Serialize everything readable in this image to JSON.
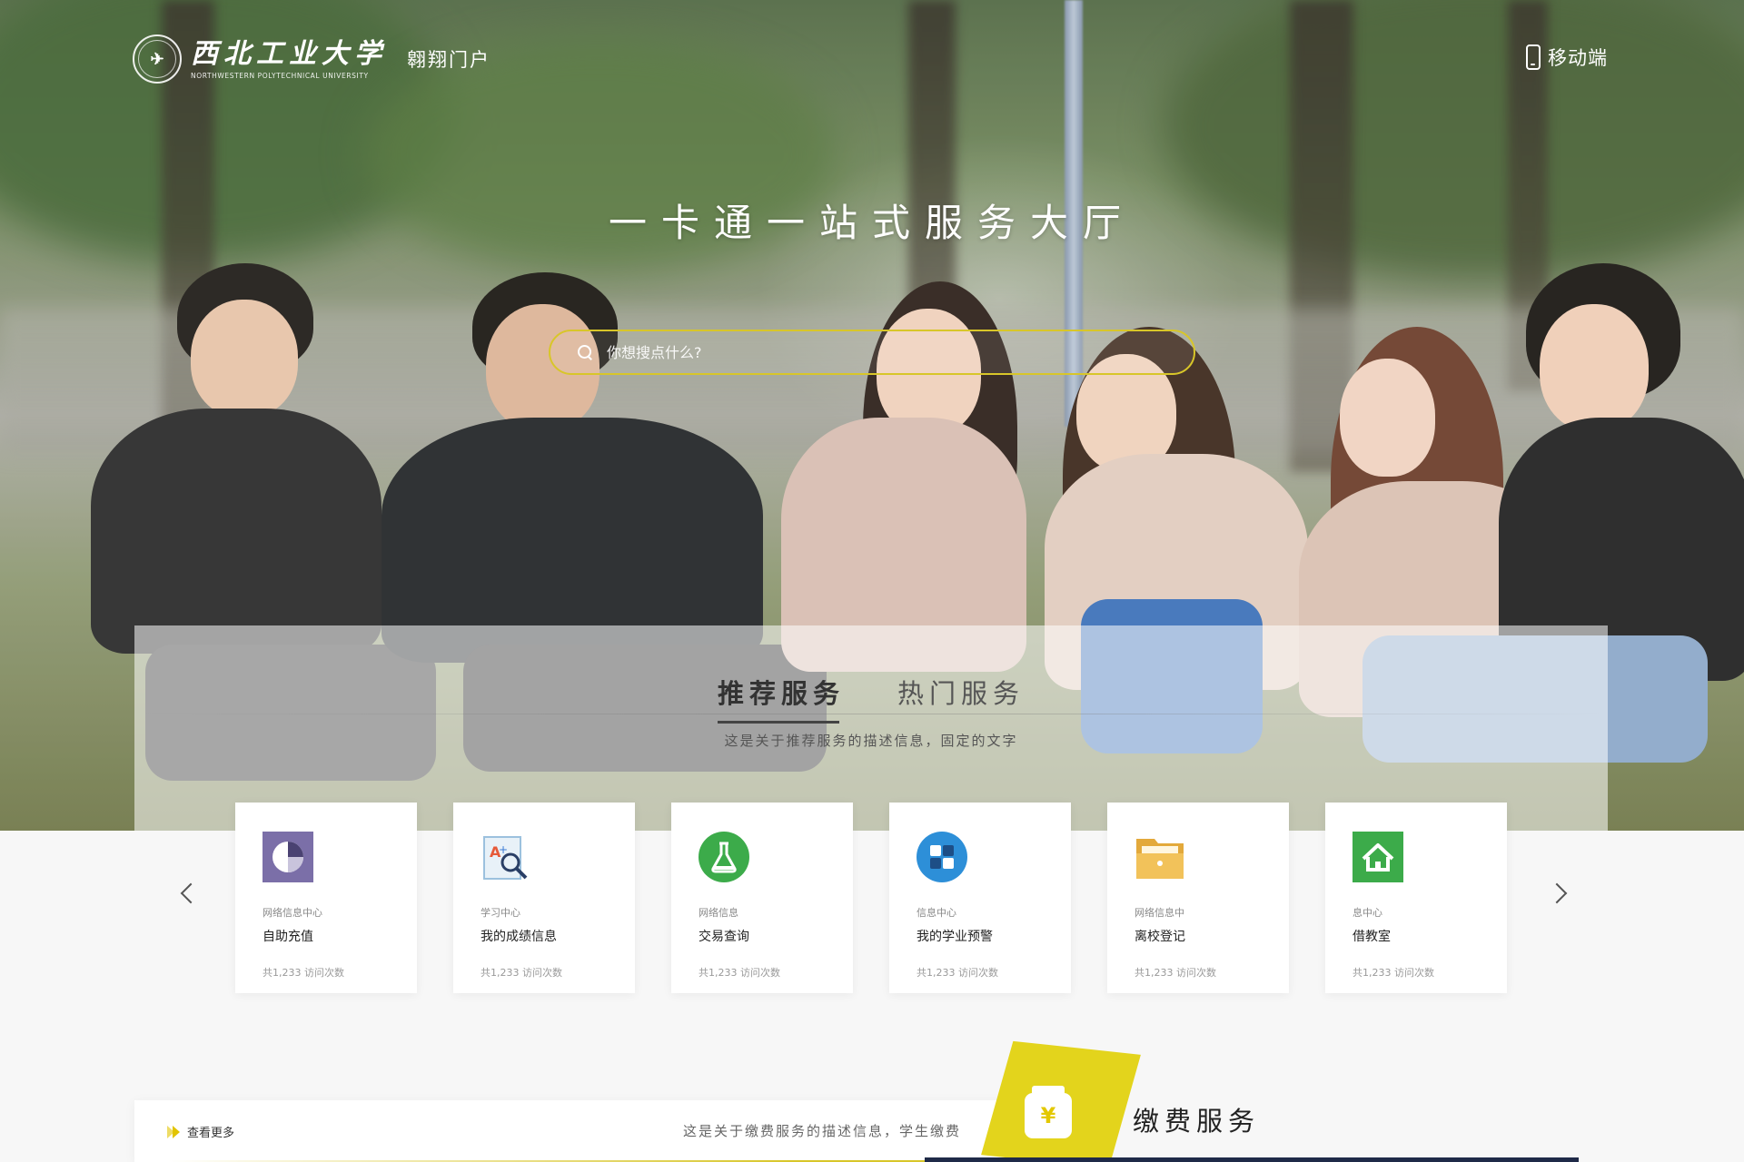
{
  "header": {
    "school_name_cn": "西北工业大学",
    "school_name_en": "NORTHWESTERN POLYTECHNICAL UNIVERSITY",
    "portal_name": "翱翔门户",
    "mobile_label": "移动端"
  },
  "hero": {
    "title": "一卡通一站式服务大厅",
    "search_placeholder": "你想搜点什么?"
  },
  "services": {
    "tabs": [
      {
        "label": "推荐服务",
        "active": true
      },
      {
        "label": "热门服务",
        "active": false
      }
    ],
    "description": "这是关于推荐服务的描述信息，固定的文字",
    "cards": [
      {
        "icon": "pie-chart-icon",
        "category": "网络信息中心",
        "name": "自助充值",
        "visits": "共1,233 访问次数",
        "color": "#7b6fa8"
      },
      {
        "icon": "grade-search-icon",
        "category": "学习中心",
        "name": "我的成绩信息",
        "visits": "共1,233 访问次数",
        "color": "#e65a3a"
      },
      {
        "icon": "flask-icon",
        "category": "网络信息",
        "name": "交易查询",
        "visits": "共1,233 访问次数",
        "color": "#3cab4a"
      },
      {
        "icon": "blocks-icon",
        "category": "信息中心",
        "name": "我的学业预警",
        "visits": "共1,233 访问次数",
        "color": "#2d8fd8"
      },
      {
        "icon": "folder-icon",
        "category": "网络信息中",
        "name": "离校登记",
        "visits": "共1,233 访问次数",
        "color": "#e3a93b"
      },
      {
        "icon": "home-icon",
        "category": "息中心",
        "name": "借教室",
        "visits": "共1,233 访问次数",
        "color": "#3cab4a"
      }
    ]
  },
  "payment": {
    "more_label": "查看更多",
    "description": "这是关于缴费服务的描述信息，学生缴费",
    "title": "缴费服务",
    "icon_glyph": "¥",
    "accent": "#e3d41c"
  }
}
